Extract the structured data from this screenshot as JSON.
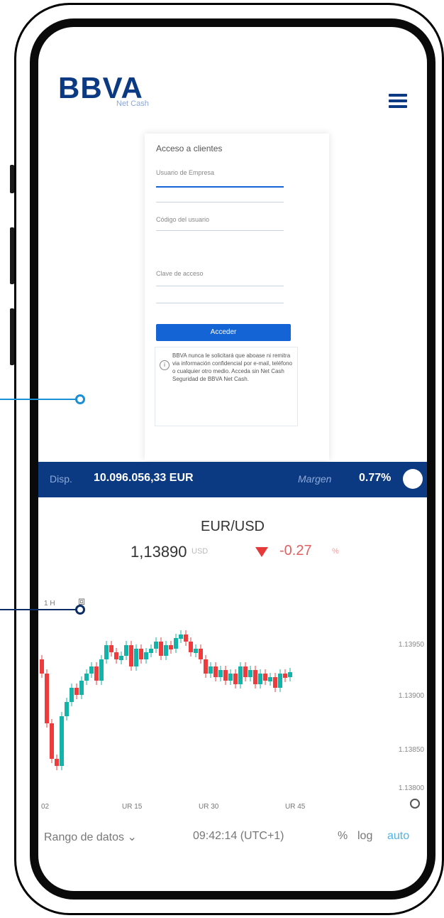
{
  "header": {
    "logo": "BBVA",
    "logo_sub": "Net Cash",
    "menu_icon": "hamburger-menu-icon"
  },
  "login": {
    "title": "Acceso a clientes",
    "fields": [
      {
        "label": "Usuario de Empresa"
      },
      {
        "label": "Código del usuario"
      },
      {
        "label": "Clave de acceso"
      }
    ],
    "submit_label": "Acceder",
    "info_text": "BBVA nunca le solicitará que aboase ni remitra via información confidencial por e-mail, teléfono o cualquier otro medio. Acceda sin Net Cash Seguridad de BBVA Net Cash."
  },
  "trading": {
    "balance_label": "Disp.",
    "balance_value": "10.096.056,33 EUR",
    "margin_label": "Margen",
    "margin_value": "0.77%",
    "pair": "EUR/USD",
    "price": "1,13890",
    "price_unit": "USD",
    "change": "-0.27",
    "change_unit": "%",
    "timeframe": "1 H",
    "chart_icon": "candlestick-icon",
    "y_ticks": [
      "1.13950",
      "1.13900",
      "1.13850",
      "1.13800"
    ],
    "x_ticks": [
      "02",
      "UR 15",
      "UR 30",
      "UR 45"
    ],
    "footer": {
      "range_label": "Rango de datos",
      "time": "09:42:14 (UTC+1)",
      "percent": "%",
      "log": "log",
      "auto": "auto"
    }
  },
  "colors": {
    "brand": "#0b3a82",
    "accent": "#1464d6",
    "up": "#12b3a8",
    "down": "#ef3b3b",
    "connector": "#1a8fd6"
  }
}
